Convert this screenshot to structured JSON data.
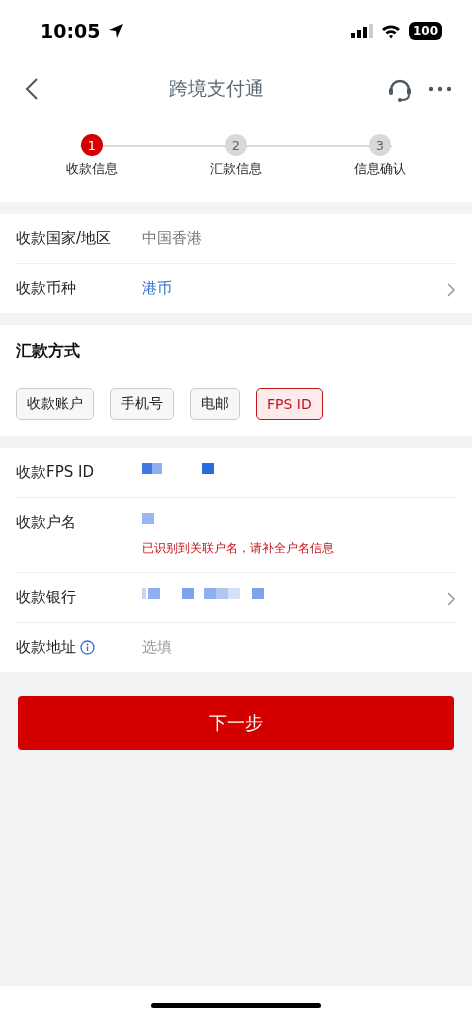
{
  "status_bar": {
    "time": "10:05",
    "battery": "100"
  },
  "nav": {
    "title": "跨境支付通"
  },
  "steps": [
    {
      "number": "1",
      "label": "收款信息",
      "selected": true
    },
    {
      "number": "2",
      "label": "汇款信息",
      "selected": false
    },
    {
      "number": "3",
      "label": "信息确认",
      "selected": false
    }
  ],
  "region_rows": [
    {
      "label": "收款国家/地区",
      "value": "中国香港",
      "kind": "plain",
      "chevron": false
    },
    {
      "label": "收款币种",
      "value": "港币",
      "kind": "link",
      "chevron": true
    }
  ],
  "method": {
    "title": "汇款方式",
    "options": [
      {
        "label": "收款账户",
        "selected": false
      },
      {
        "label": "手机号",
        "selected": false
      },
      {
        "label": "电邮",
        "selected": false
      },
      {
        "label": "FPS ID",
        "selected": true
      }
    ]
  },
  "recipient_fields": [
    {
      "label": "收款FPS ID",
      "kind": "masked",
      "chevron": false,
      "info": false
    },
    {
      "label": "收款户名",
      "kind": "masked",
      "hint": "已识别到关联户名，请补全户名信息",
      "chevron": false,
      "info": false
    },
    {
      "label": "收款银行",
      "kind": "masked",
      "chevron": true,
      "info": false
    },
    {
      "label": "收款地址",
      "kind": "empty",
      "placeholder": "选填",
      "chevron": false,
      "info": true
    }
  ],
  "submit": {
    "label": "下一步"
  }
}
